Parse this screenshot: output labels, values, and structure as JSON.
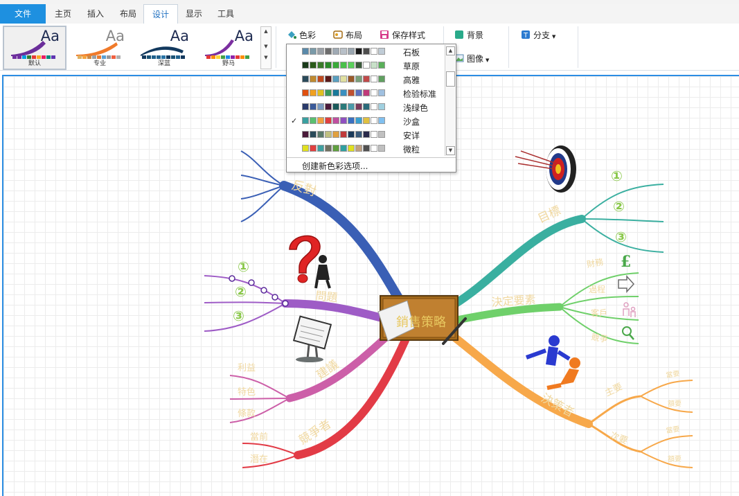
{
  "menu": {
    "tabs": [
      {
        "label": "文件",
        "style": "file"
      },
      {
        "label": "主页",
        "style": ""
      },
      {
        "label": "插入",
        "style": ""
      },
      {
        "label": "布局",
        "style": ""
      },
      {
        "label": "设计",
        "style": "active"
      },
      {
        "label": "显示",
        "style": ""
      },
      {
        "label": "工具",
        "style": ""
      }
    ]
  },
  "ribbon": {
    "themes": [
      {
        "label": "默认",
        "aa": "Aa",
        "curve": "#6a2e9a",
        "sw": [
          "#7030a0",
          "#7030a0",
          "#00a0e0",
          "#2e7d32",
          "#e53935",
          "#f9a825",
          "#e91e63",
          "#00897b",
          "#5e35b1"
        ]
      },
      {
        "label": "专业",
        "aa": "Aa",
        "curve": "#f07a2a",
        "sw": [
          "#e0b060",
          "#f4a340",
          "#cc8844",
          "#9aa0a6",
          "#e87a30",
          "#5da0d0",
          "#999999",
          "#f06040",
          "#b0b0b0"
        ]
      },
      {
        "label": "深蓝",
        "aa": "Aa",
        "curve": "#12395e",
        "sw": [
          "#12395e",
          "#1a5276",
          "#1f618d",
          "#21618c",
          "#2874a6",
          "#12395e",
          "#1a5276",
          "#1f618d",
          "#12395e"
        ]
      },
      {
        "label": "野马",
        "aa": "Aa",
        "curve": "#7b2fa0",
        "sw": [
          "#e53935",
          "#fb8c00",
          "#fdd835",
          "#43a047",
          "#1e88e5",
          "#8e24aa",
          "#e53935",
          "#fb8c00",
          "#43a047"
        ]
      }
    ],
    "color_button": "色彩",
    "layout_button": "布局",
    "save_style_button": "保存样式",
    "background_button": "背景",
    "image_button": "图像",
    "branch_button": "分支"
  },
  "dropdown": {
    "rows": [
      {
        "name": "石板",
        "checked": false,
        "colors": [
          "#5a8aaa",
          "#7a9aa8",
          "#9aa0a6",
          "#6d6d6d",
          "#a0aab4",
          "#b8c0c8",
          "#9aa6b0",
          "#1a1a1a",
          "#4d4d4d",
          "#ffffff",
          "#c0ccd6"
        ]
      },
      {
        "name": "草原",
        "checked": false,
        "colors": [
          "#1a3a1a",
          "#2a5a1a",
          "#3a7a2a",
          "#2a8a2a",
          "#3aaa3a",
          "#4ac04a",
          "#5ad05a",
          "#3a5a3a",
          "#ffffff",
          "#c8e0c8",
          "#5ab05a"
        ]
      },
      {
        "name": "高雅",
        "checked": false,
        "colors": [
          "#2a4a5a",
          "#c08a30",
          "#c04a20",
          "#5a1a1a",
          "#5aa0c0",
          "#e0e0a0",
          "#9a5a2a",
          "#7aa07a",
          "#c04a4a",
          "#ffffff",
          "#60a060"
        ]
      },
      {
        "name": "检验标准",
        "checked": false,
        "colors": [
          "#e05010",
          "#f0a020",
          "#e0c020",
          "#3a9a5a",
          "#1a7a9a",
          "#3a90c0",
          "#c05030",
          "#5a70c0",
          "#c03a7a",
          "#ffffff",
          "#a0c0e0"
        ]
      },
      {
        "name": "浅绿色",
        "checked": false,
        "colors": [
          "#2a3a6a",
          "#3a5a9a",
          "#7a9ac0",
          "#4a1a3a",
          "#1a5a5a",
          "#2a7a7a",
          "#4a9aaa",
          "#7a3a5a",
          "#2a6a7a",
          "#ffffff",
          "#a0d0e0"
        ]
      },
      {
        "name": "沙盒",
        "checked": true,
        "colors": [
          "#3aa0a0",
          "#5ac070",
          "#f0a040",
          "#e04040",
          "#c050a0",
          "#9050c0",
          "#3a70c0",
          "#3aa0d0",
          "#e0c040",
          "#ffffff",
          "#80c0f0"
        ]
      },
      {
        "name": "安详",
        "checked": false,
        "colors": [
          "#4a1a3a",
          "#2a4a5a",
          "#5a7a6a",
          "#c0c080",
          "#e0a040",
          "#c03a3a",
          "#1a3a5a",
          "#3a5a7a",
          "#2a2a4a",
          "#ffffff",
          "#c0c0c0"
        ]
      },
      {
        "name": "微粒",
        "checked": false,
        "colors": [
          "#e0e020",
          "#e04040",
          "#40a0a0",
          "#707060",
          "#60a040",
          "#30a0a0",
          "#e0e020",
          "#c0a080",
          "#505050",
          "#ffffff",
          "#c0c0c0"
        ]
      }
    ],
    "create_new": "创建新色彩选项..."
  },
  "mindmap": {
    "center": "銷售策略",
    "branches": [
      {
        "label": "反對",
        "color": "#3a5fb5"
      },
      {
        "label": "問題",
        "color": "#9e5cc6",
        "items": [
          "①",
          "②",
          "③"
        ]
      },
      {
        "label": "建議",
        "color": "#cc5fa8",
        "items": [
          "利益",
          "特色",
          "條款"
        ]
      },
      {
        "label": "競爭者",
        "color": "#e23b46",
        "items": [
          "當前",
          "潛在"
        ]
      },
      {
        "label": "目標",
        "color": "#3aafa0",
        "items": [
          "①",
          "②",
          "③"
        ]
      },
      {
        "label": "決定要素",
        "color": "#6fd06a",
        "items": [
          "財務",
          "過程",
          "客戶",
          "競爭"
        ]
      },
      {
        "label": "決策者",
        "color": "#f7a84a",
        "subs": [
          {
            "label": "主要",
            "items": [
              "當要",
              "額要"
            ]
          },
          {
            "label": "次要",
            "items": [
              "當要",
              "額要"
            ]
          }
        ]
      }
    ]
  }
}
